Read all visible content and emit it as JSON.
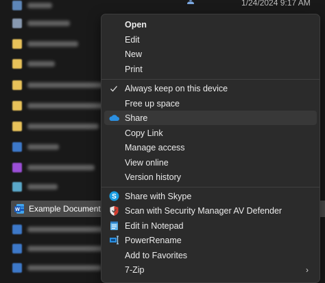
{
  "background": {
    "date_text": "1/24/2024 9:17 AM",
    "selected_file_name": "Example Document"
  },
  "context_menu": {
    "group1": [
      {
        "label": "Open",
        "bold": true
      },
      {
        "label": "Edit"
      },
      {
        "label": "New"
      },
      {
        "label": "Print"
      }
    ],
    "group2": [
      {
        "label": "Always keep on this device",
        "icon": "checkmark-icon"
      },
      {
        "label": "Free up space"
      },
      {
        "label": "Share",
        "icon": "onedrive-cloud-icon"
      },
      {
        "label": "Copy Link"
      },
      {
        "label": "Manage access"
      },
      {
        "label": "View online"
      },
      {
        "label": "Version history"
      }
    ],
    "group3": [
      {
        "label": "Share with Skype",
        "icon": "skype-icon"
      },
      {
        "label": "Scan with Security Manager AV Defender",
        "icon": "shield-icon"
      },
      {
        "label": "Edit in Notepad",
        "icon": "notepad-icon"
      },
      {
        "label": "PowerRename",
        "icon": "powerrename-icon"
      },
      {
        "label": "Add to Favorites"
      },
      {
        "label": "7-Zip",
        "submenu": true
      }
    ]
  },
  "colors": {
    "menu_bg": "#2b2b2b",
    "accent_blue": "#2b8fe0",
    "selection_bg": "#4a4a4a"
  }
}
